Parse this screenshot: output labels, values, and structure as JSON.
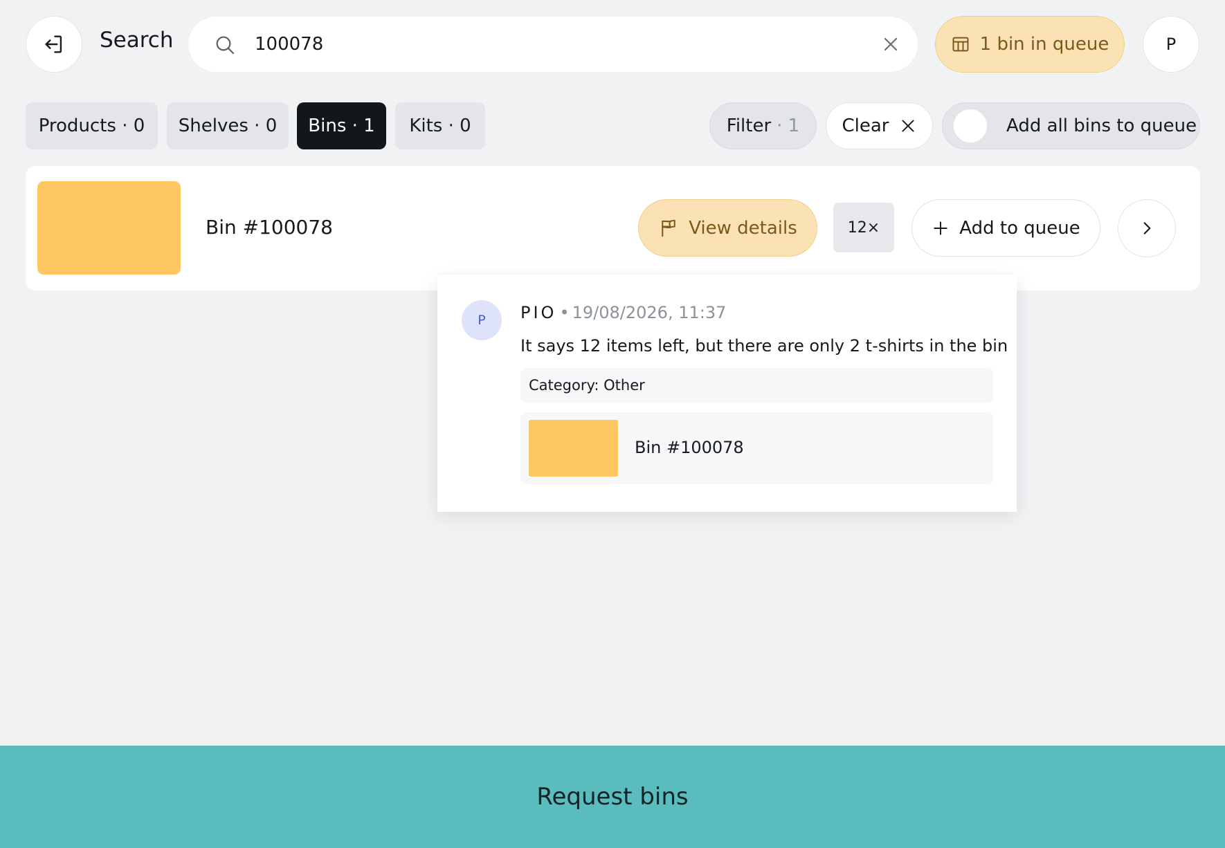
{
  "header": {
    "title": "Search",
    "search": {
      "value": "100078"
    },
    "queue_status": "1 bin in queue",
    "profile_initial": "P"
  },
  "tabs": [
    {
      "label": "Products · 0",
      "active": false
    },
    {
      "label": "Shelves · 0",
      "active": false
    },
    {
      "label": "Bins · 1",
      "active": true
    },
    {
      "label": "Kits · 0",
      "active": false
    }
  ],
  "toolbar": {
    "filter_label": "Filter",
    "filter_count": "· 1",
    "clear_label": "Clear",
    "add_all_label": "Add all bins to queue",
    "add_all_enabled": false
  },
  "results": [
    {
      "title": "Bin #100078",
      "color": "#ffc764",
      "view_details_label": "View details",
      "quantity": "12×",
      "add_label": "Add to queue"
    }
  ],
  "popover": {
    "avatar_initial": "P",
    "author": "PIO",
    "separator": "•",
    "timestamp": "19/08/2026, 11:37",
    "text": "It says 12 items left, but there are only 2 t-shirts in the bin",
    "category": "Category: Other",
    "linked_bin": {
      "title": "Bin #100078",
      "color": "#ffc764"
    }
  },
  "footer": {
    "request_label": "Request bins"
  },
  "colors": {
    "accent_teal": "#5bbcbe",
    "queue_amber_bg": "#fbe2b4",
    "active_tab": "#12171c",
    "background": "#f1f2f4"
  }
}
